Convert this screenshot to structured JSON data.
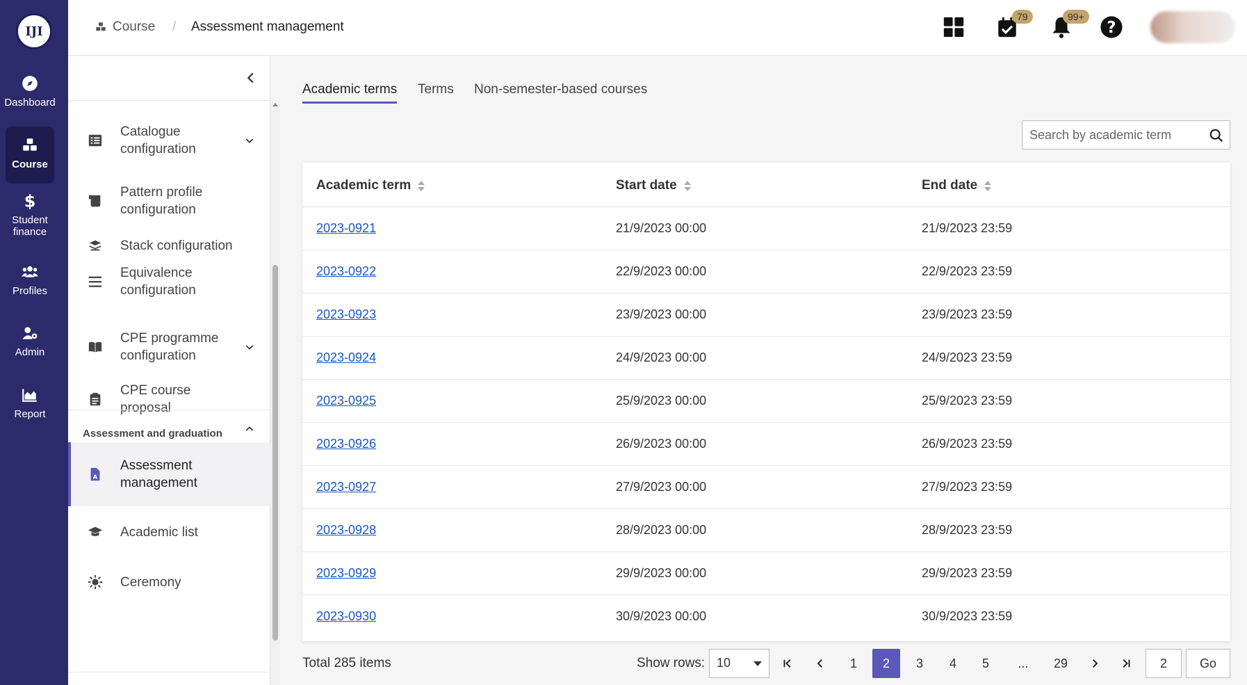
{
  "nav": {
    "logo_text": "IJI",
    "items": [
      {
        "label": "Dashboard",
        "icon": "compass-icon"
      },
      {
        "label": "Course",
        "icon": "cubes-icon"
      },
      {
        "label": "Student finance",
        "icon": "dollar-icon"
      },
      {
        "label": "Profiles",
        "icon": "users-icon"
      },
      {
        "label": "Admin",
        "icon": "user-gear-icon"
      },
      {
        "label": "Report",
        "icon": "chart-area-icon"
      }
    ]
  },
  "header": {
    "breadcrumb_root": "Course",
    "breadcrumb_sep": "/",
    "breadcrumb_current": "Assessment management",
    "tasks_badge": "79",
    "notifications_badge": "99+"
  },
  "sidebar": {
    "items": [
      {
        "label": "Catalogue configuration",
        "icon": "list-icon"
      },
      {
        "label": "Pattern profile configuration",
        "icon": "scroll-icon"
      },
      {
        "label": "Stack configuration",
        "icon": "stack-icon"
      },
      {
        "label": "Equivalence configuration",
        "icon": "bars-icon"
      },
      {
        "label": "CPE programme configuration",
        "icon": "book-icon"
      },
      {
        "label": "CPE course proposal",
        "icon": "clipboard-icon"
      },
      {
        "label": "Assessment management",
        "icon": "file-a-icon"
      },
      {
        "label": "Academic list",
        "icon": "graduation-cap-icon"
      },
      {
        "label": "Ceremony",
        "icon": "sun-icon"
      }
    ],
    "section_label": "Assessment and graduation"
  },
  "tabs": [
    "Academic terms",
    "Terms",
    "Non-semester-based courses"
  ],
  "search": {
    "placeholder": "Search by academic term"
  },
  "table": {
    "headers": [
      "Academic term",
      "Start date",
      "End date"
    ],
    "rows": [
      [
        "2023-0921",
        "21/9/2023 00:00",
        "21/9/2023 23:59"
      ],
      [
        "2023-0922",
        "22/9/2023 00:00",
        "22/9/2023 23:59"
      ],
      [
        "2023-0923",
        "23/9/2023 00:00",
        "23/9/2023 23:59"
      ],
      [
        "2023-0924",
        "24/9/2023 00:00",
        "24/9/2023 23:59"
      ],
      [
        "2023-0925",
        "25/9/2023 00:00",
        "25/9/2023 23:59"
      ],
      [
        "2023-0926",
        "26/9/2023 00:00",
        "26/9/2023 23:59"
      ],
      [
        "2023-0927",
        "27/9/2023 00:00",
        "27/9/2023 23:59"
      ],
      [
        "2023-0928",
        "28/9/2023 00:00",
        "28/9/2023 23:59"
      ],
      [
        "2023-0929",
        "29/9/2023 00:00",
        "29/9/2023 23:59"
      ],
      [
        "2023-0930",
        "30/9/2023 00:00",
        "30/9/2023 23:59"
      ]
    ]
  },
  "pagination": {
    "total": "Total 285 items",
    "show_rows_label": "Show rows:",
    "rows_value": "10",
    "pages": [
      "1",
      "2",
      "3",
      "4",
      "5",
      "...",
      "29"
    ],
    "current_page": "2",
    "goto_value": "2",
    "go_label": "Go"
  },
  "colors": {
    "nav_bg": "#2b2a6b",
    "accent": "#5a58b8",
    "link": "#1a56c8",
    "badge": "#c4a46b"
  }
}
